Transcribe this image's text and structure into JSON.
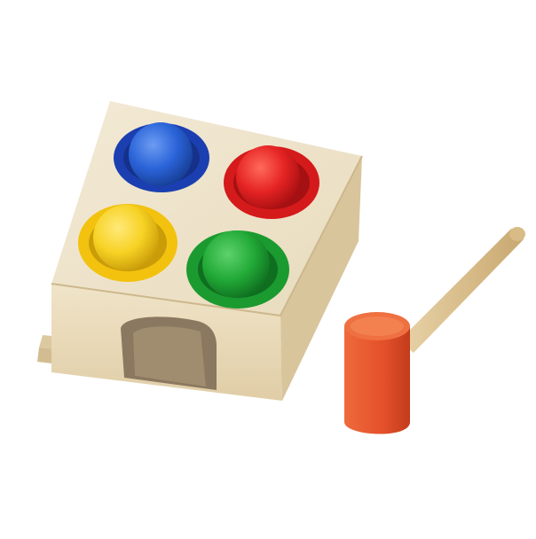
{
  "image": {
    "background": "#ffffff"
  },
  "toy": {
    "wood_light": "#efe3c8",
    "wood_mid": "#e2cfa8",
    "wood_dark": "#c9b48a",
    "opening_shadow": "#8a7860",
    "balls": [
      {
        "name": "blue",
        "ring": "#1b3fb0",
        "ball": "#2a63d8"
      },
      {
        "name": "red",
        "ring": "#d41a1a",
        "ball": "#e52323"
      },
      {
        "name": "yellow",
        "ring": "#f2c20f",
        "ball": "#f7d224"
      },
      {
        "name": "green",
        "ring": "#1b9a2f",
        "ball": "#22aa37"
      }
    ]
  },
  "hammer": {
    "head_color": "#e4502a",
    "handle_color": "#dcc08e"
  }
}
